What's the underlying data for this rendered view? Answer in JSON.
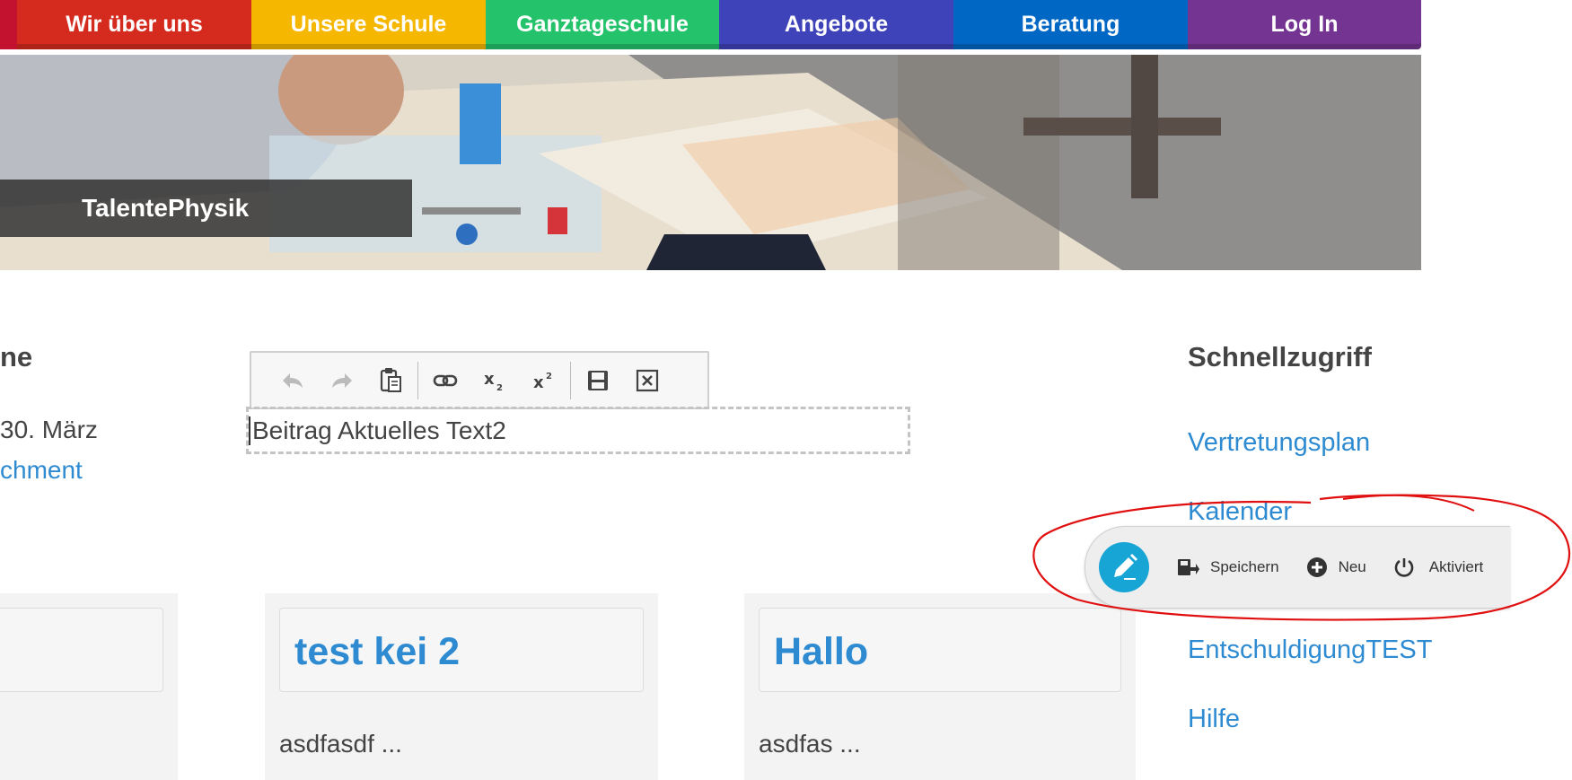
{
  "nav": {
    "items": [
      {
        "label": "Wir über uns",
        "color": "#d52a1e"
      },
      {
        "label": "Unsere Schule",
        "color": "#f6b700"
      },
      {
        "label": "Ganztageschule",
        "color": "#24c36b"
      },
      {
        "label": "Angebote",
        "color": "#3f43b9"
      },
      {
        "label": "Beratung",
        "color": "#0068c4"
      },
      {
        "label": "Log In",
        "color": "#743592"
      }
    ]
  },
  "hero": {
    "caption": "TalentePhysik"
  },
  "left_col": {
    "heading_fragment": "ne",
    "date_fragment": "30. März",
    "link_fragment": "chment"
  },
  "editor": {
    "toolbar_icons": [
      "undo-icon",
      "redo-icon",
      "paste-icon",
      "link-icon",
      "subscript-icon",
      "superscript-icon",
      "save-icon",
      "close-icon"
    ],
    "content": "Beitrag Aktuelles Text2"
  },
  "sidebar": {
    "heading": "Schnellzugriff",
    "links": [
      "Vertretungsplan",
      "Kalender",
      "EntschuldigungTEST",
      "Hilfe"
    ]
  },
  "cards": [
    {
      "title": "",
      "desc": ""
    },
    {
      "title": "test kei 2",
      "desc": "asdfasdf ..."
    },
    {
      "title": "Hallo",
      "desc": "asdfas ..."
    }
  ],
  "editbar": {
    "save_label": "Speichern",
    "new_label": "Neu",
    "active_label": "Aktiviert"
  },
  "colors": {
    "link": "#2f8bd1",
    "edit_accent": "#17a5d6",
    "annotation": "#e01010"
  }
}
